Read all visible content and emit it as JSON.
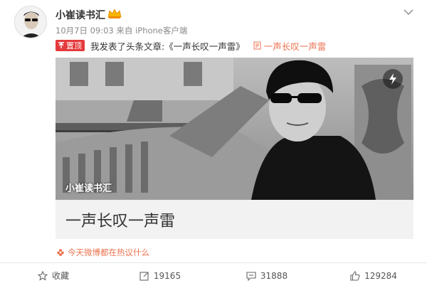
{
  "post": {
    "username": "小崔读书汇",
    "time": "10月7日 09:03",
    "via_prefix": "来自",
    "source": "iPhone客户端",
    "pin_label": "置顶",
    "announcement": "我发表了头条文章:《一声长叹一声雷》",
    "article_link_text": "一声长叹一声雷"
  },
  "card": {
    "watermark": "小崔读书汇",
    "title": "一声长叹一声雷"
  },
  "hot_topic": "今天微博都在热议什么",
  "actions": {
    "favorite_label": "收藏",
    "repost_count": "19165",
    "comment_count": "31888",
    "like_count": "129284"
  },
  "colors": {
    "accent": "#eb7350",
    "pin": "#e4393c",
    "badge": "#f7b500"
  }
}
